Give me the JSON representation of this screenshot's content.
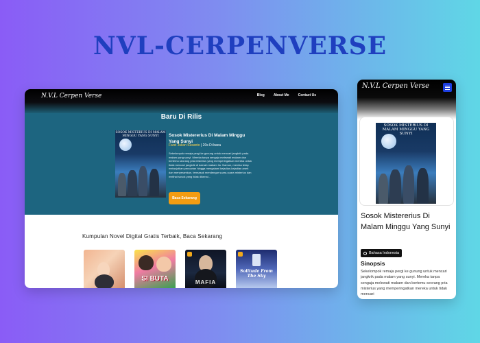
{
  "headline": "NVL-CERPENVERSE",
  "brand": "N.V.L Cerpen Verse",
  "desktop": {
    "nav": {
      "items": [
        "Blog",
        "About Me",
        "Contact Us"
      ]
    },
    "hero": {
      "title": "Baru Di Rilis",
      "cover_title": "SOSOK MISTERIUS DI MALAM MINGGU YANG SUNYI",
      "book_title": "Sosok Mistererius Di Malam Minggu Yang Sunyi",
      "author": "Farel Julian Susanto",
      "read_time": " | 20s Di baca",
      "description": "Sekelompok remaja pergi ke gunung untuk mencari jangkrik pada malam yang sunyi. Mereka tanpa sengaja melewati makam dan bertemu seorang pria misterius yang memperingatkan mereka untuk tidak mencari jangkrik di daerah makam itu. Namun, mereka tetap melanjutkan pencarian hingga mengalami kejadian-kejadian aneh dan menyeramkan, termasuk mendengar suara-suara misterius dan melihat sosok yang tidak dikenal...",
      "button": "Baca Sekarang"
    },
    "collection": {
      "title": "Kumpulan Novel Digital Gratis Terbaik, Baca Sekarang",
      "cards": [
        "",
        "SI BUTA",
        "MAFIA",
        "Solitude From The Sky"
      ]
    }
  },
  "mobile": {
    "book_title": "Sosok Mistererius Di Malam Minggu Yang Sunyi",
    "language": "Bahasa Indonesia",
    "sinopsis_heading": "Sinopsis",
    "sinopsis": "Sekelompok remaja pergi ke gunung untuk mencari jangkrik pada malam yang sunyi. Mereka tanpa sengaja melewati makam dan bertemu seorang pria misterius yang memperingatkan mereka untuk tidak mencari"
  },
  "colors": {
    "headline": "#1f3fbf",
    "hero_bg": "#1d6580",
    "accent_button": "#f39c12",
    "menu_button": "#1d3fe0"
  },
  "icons": {
    "menu": "hamburger-icon",
    "language": "globe-icon"
  }
}
